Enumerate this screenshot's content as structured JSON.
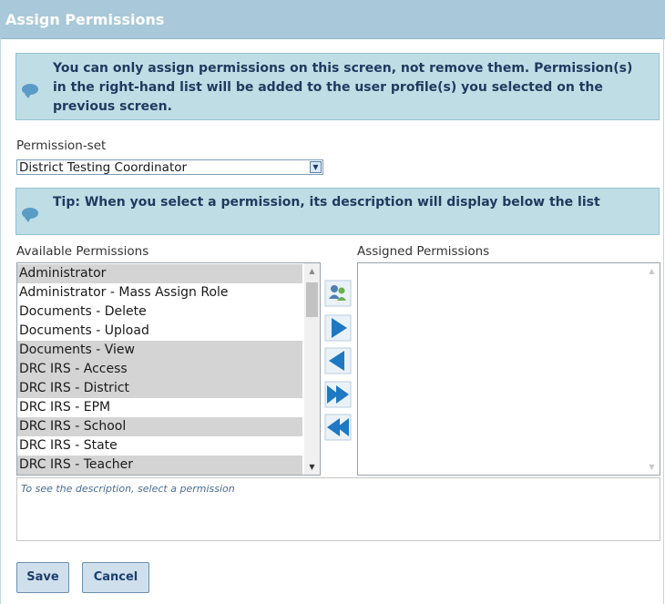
{
  "window": {
    "title": "Assign Permissions"
  },
  "info": {
    "warning": "You can only assign permissions on this screen, not remove them. Permission(s) in the right-hand list will be added to the user profile(s) you selected on the previous screen.",
    "tip": "Tip: When you select a permission, its description will display below the list"
  },
  "permission_set": {
    "label": "Permission-set",
    "selected": "District Testing Coordinator"
  },
  "available": {
    "label": "Available Permissions",
    "items": [
      {
        "label": "Administrator",
        "selected": true
      },
      {
        "label": "Administrator - Mass Assign Role",
        "selected": false
      },
      {
        "label": "Documents - Delete",
        "selected": false
      },
      {
        "label": "Documents - Upload",
        "selected": false
      },
      {
        "label": "Documents - View",
        "selected": true
      },
      {
        "label": "DRC IRS - Access",
        "selected": true
      },
      {
        "label": "DRC IRS - District",
        "selected": true
      },
      {
        "label": "DRC IRS - EPM",
        "selected": false
      },
      {
        "label": "DRC IRS - School",
        "selected": true
      },
      {
        "label": "DRC IRS - State",
        "selected": false
      },
      {
        "label": "DRC IRS - Teacher",
        "selected": true
      }
    ]
  },
  "assigned": {
    "label": "Assigned Permissions",
    "items": []
  },
  "description": {
    "placeholder": "To see the description, select a permission"
  },
  "buttons": {
    "save": "Save",
    "cancel": "Cancel"
  },
  "icons": {
    "assign_group": "users-add-icon",
    "move_right": "arrow-right-icon",
    "move_left": "arrow-left-icon",
    "move_all_right": "double-arrow-right-icon",
    "move_all_left": "double-arrow-left-icon"
  },
  "colors": {
    "header": "#a9c9da",
    "info_bg": "#bfdde5",
    "arrow_blue": "#1e78c2",
    "selected_row": "#d4d4d4"
  }
}
